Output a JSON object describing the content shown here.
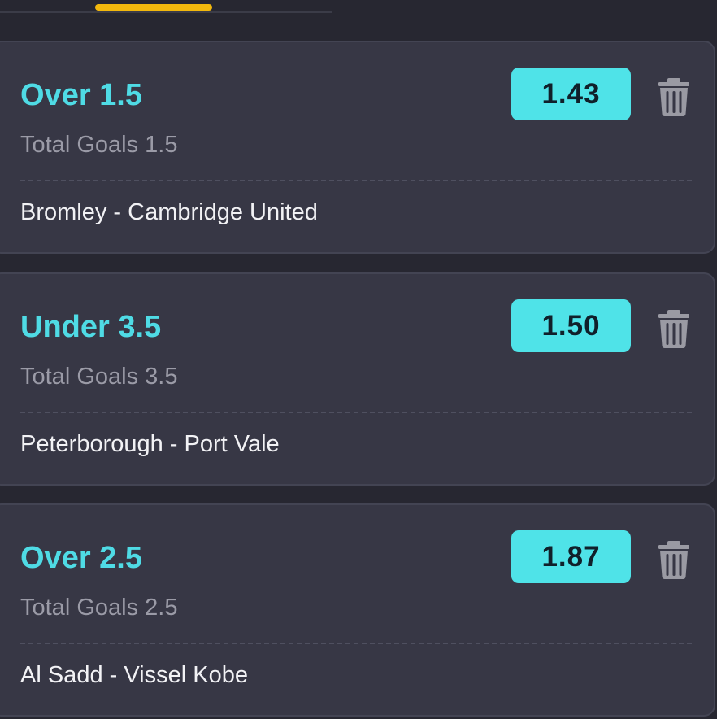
{
  "bets": [
    {
      "selection": "Over 1.5",
      "market": "Total Goals 1.5",
      "match": "Bromley - Cambridge United",
      "odds": "1.43",
      "delete_icon": "trash-icon"
    },
    {
      "selection": "Under 3.5",
      "market": "Total Goals 3.5",
      "match": "Peterborough - Port Vale",
      "odds": "1.50",
      "delete_icon": "trash-icon"
    },
    {
      "selection": "Over 2.5",
      "market": "Total Goals 2.5",
      "match": "Al Sadd - Vissel Kobe",
      "odds": "1.87",
      "delete_icon": "trash-icon"
    }
  ],
  "colors": {
    "background": "#272731",
    "card": "#373745",
    "selection_accent": "#4fdbe5",
    "odds_button": "#4fe3e8",
    "tab_indicator": "#f2b80d",
    "icon": "#9a9aa3"
  }
}
